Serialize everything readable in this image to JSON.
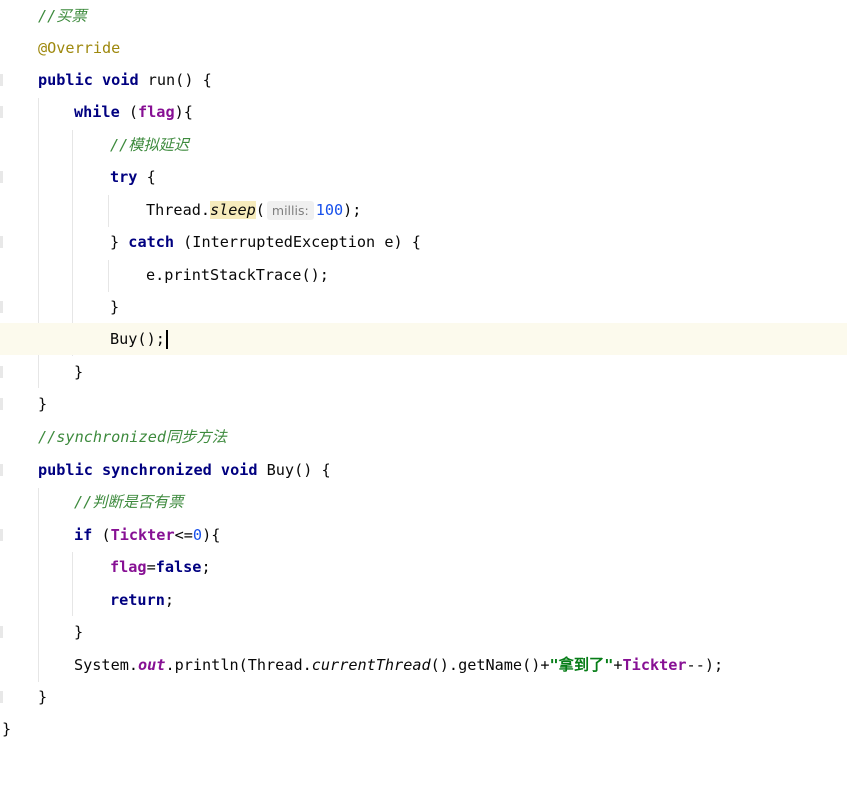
{
  "editor": {
    "lines": {
      "l1_comment": "//买票",
      "l2_annotation": "@Override",
      "l3_kw_public": "public",
      "l3_kw_void": "void",
      "l3_rest": " run() {",
      "l4_kw_while": "while",
      "l4_open": " (",
      "l4_field": "flag",
      "l4_close": "){",
      "l5_comment": "//模拟延迟",
      "l6_kw_try": "try",
      "l6_rest": " {",
      "l7_class": "Thread.",
      "l7_method": "sleep",
      "l7_paren": "(",
      "l7_hint": "millis:",
      "l7_num": "100",
      "l7_end": ");",
      "l8_brace": "} ",
      "l8_kw_catch": "catch",
      "l8_rest": " (InterruptedException e) {",
      "l9_text": "e.printStackTrace();",
      "l10_text": "}",
      "l11_text": "Buy();",
      "l12_text": "}",
      "l13_text": "}",
      "l14_comment_a": "//synchronized",
      "l14_comment_b": "同步方法",
      "l15_kw_public": "public",
      "l15_kw_sync": "synchronized",
      "l15_kw_void": "void",
      "l15_rest": " Buy() {",
      "l16_comment": "//判断是否有票",
      "l17_kw_if": "if",
      "l17_open": " (",
      "l17_field": "Tickter",
      "l17_op": "<=",
      "l17_num": "0",
      "l17_close": "){",
      "l18_field": "flag",
      "l18_eq": "=",
      "l18_kw": "false",
      "l18_semi": ";",
      "l19_kw": "return",
      "l19_semi": ";",
      "l20_text": "}",
      "l21_sys": "System.",
      "l21_out": "out",
      "l21_println": ".println(Thread.",
      "l21_current": "currentThread",
      "l21_getname": "().getName()+",
      "l21_str": "\"拿到了\"",
      "l21_plus": "+",
      "l21_field": "Tickter",
      "l21_end": "--);",
      "l22_text": "}",
      "l23_text": "}"
    }
  }
}
